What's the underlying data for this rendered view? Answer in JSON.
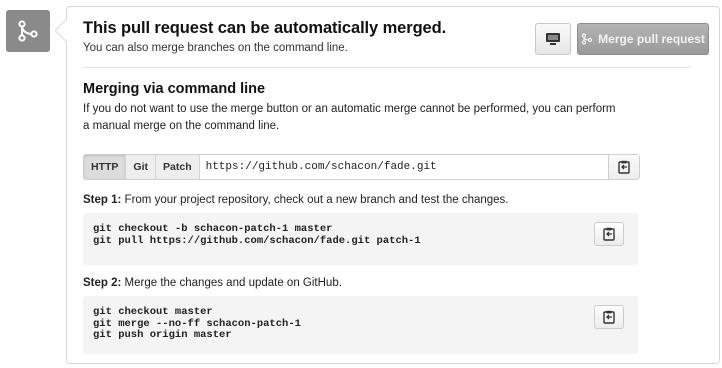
{
  "header": {
    "title": "This pull request can be automatically merged.",
    "subtitle": "You can also merge branches on the command line.",
    "merge_button_label": "Merge pull request"
  },
  "cli": {
    "title": "Merging via command line",
    "description": "If you do not want to use the merge button or an automatic merge cannot be performed, you can perform a manual merge on the command line.",
    "protocols": [
      "HTTP",
      "Git",
      "Patch"
    ],
    "selected_protocol": "HTTP",
    "clone_url": "https://github.com/schacon/fade.git"
  },
  "steps": [
    {
      "label": "Step 1:",
      "text": " From your project repository, check out a new branch and test the changes.",
      "lines": [
        "git checkout -b schacon-patch-1 master",
        "git pull https://github.com/schacon/fade.git patch-1"
      ]
    },
    {
      "label": "Step 2:",
      "text": " Merge the changes and update on GitHub.",
      "lines": [
        "git checkout master",
        "git merge --no-ff schacon-patch-1",
        "git push origin master"
      ]
    }
  ],
  "icons": {
    "side": "git-merge-icon",
    "desktop": "desktop-icon",
    "clipboard": "clipboard-icon"
  },
  "colors": {
    "merge_button": "#a6a6a6",
    "side_icon_bg": "#8a8a8a"
  }
}
